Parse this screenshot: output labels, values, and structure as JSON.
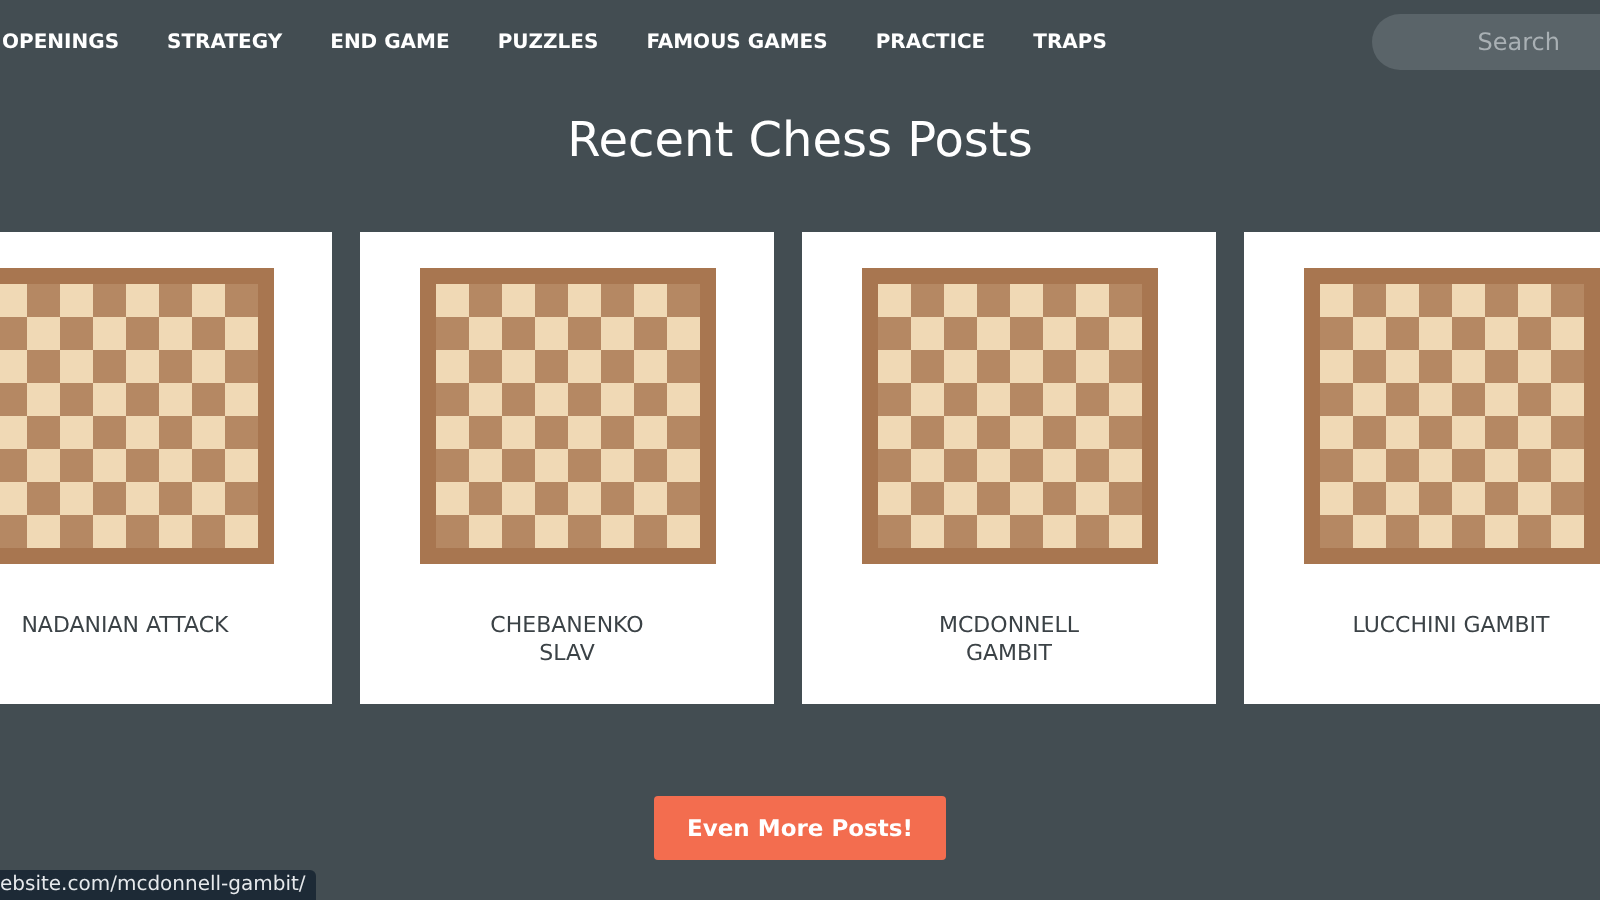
{
  "nav": {
    "items": [
      {
        "label": "OPENINGS"
      },
      {
        "label": "STRATEGY"
      },
      {
        "label": "END GAME"
      },
      {
        "label": "PUZZLES"
      },
      {
        "label": "FAMOUS GAMES"
      },
      {
        "label": "PRACTICE"
      },
      {
        "label": "TRAPS"
      }
    ],
    "search": {
      "placeholder": "Search"
    }
  },
  "heading": "Recent Chess Posts",
  "posts": [
    {
      "title": "NADANIAN ATTACK"
    },
    {
      "title": "CHEBANENKO SLAV"
    },
    {
      "title": "MCDONNELL GAMBIT"
    },
    {
      "title": "LUCCHINI GAMBIT"
    }
  ],
  "more_button": "Even More Posts!",
  "status_url": "ebsite.com/mcdonnell-gambit/"
}
